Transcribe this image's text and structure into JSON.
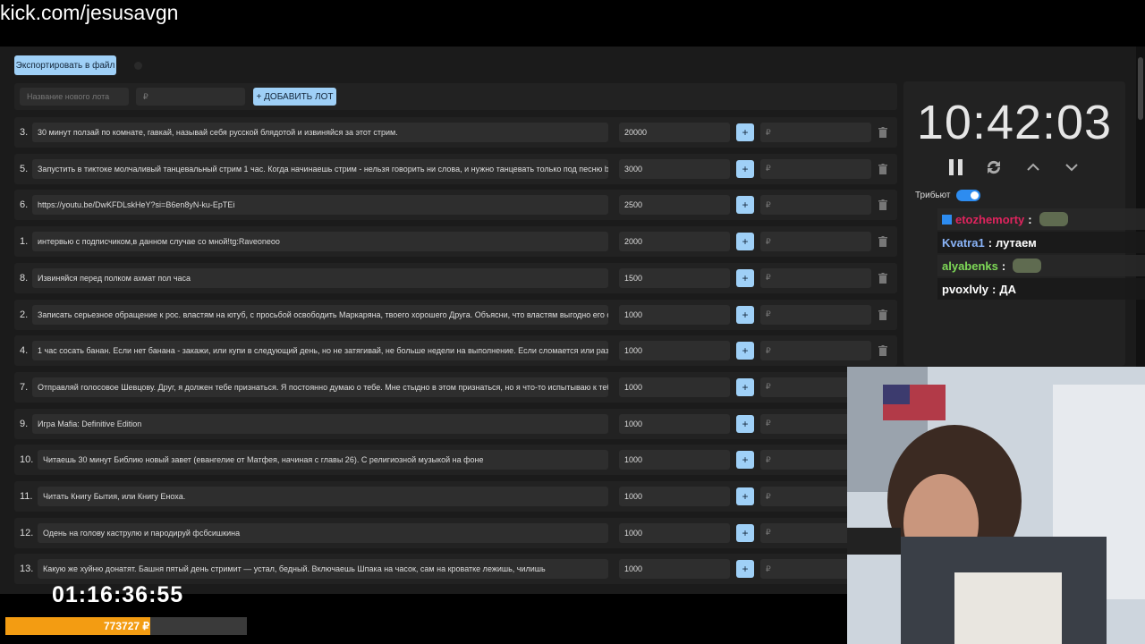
{
  "browser": {
    "url": "kick.com/jesusavgn"
  },
  "toolbar": {
    "export_label": "Экспортировать в файл"
  },
  "new_lot": {
    "name_placeholder": "Название нового лота",
    "amount_placeholder": "₽",
    "add_label": "+ ДОБАВИТЬ ЛОТ"
  },
  "lots": [
    {
      "num": "3.",
      "name": "30 минут ползай по комнате, гавкай, называй себя русской блядотой и извиняйся за этот стрим.",
      "amount": "20000",
      "plus": "+",
      "add_placeholder": "₽"
    },
    {
      "num": "5.",
      "name": "Запустить в тиктоке молчаливый танцевальный стрим 1 час. Когда начинаешь стрим - нельзя говорить ни слова, и нужно танцевать только под песню brid",
      "amount": "3000",
      "plus": "+",
      "add_placeholder": "₽"
    },
    {
      "num": "6.",
      "name": "https://youtu.be/DwKFDLskHeY?si=B6en8yN-ku-EpTEi",
      "amount": "2500",
      "plus": "+",
      "add_placeholder": "₽"
    },
    {
      "num": "1.",
      "name": "интервью с подписчиком,в данном случае со мной!tg:Raveoneoo",
      "amount": "2000",
      "plus": "+",
      "add_placeholder": "₽"
    },
    {
      "num": "8.",
      "name": "Извиняйся перед полком ахмат пол часа",
      "amount": "1500",
      "plus": "+",
      "add_placeholder": "₽"
    },
    {
      "num": "2.",
      "name": "Записать серьезное обращение к рос. властям на ютуб, с просьбой освободить Маркаряна, твоего хорошего Друга. Объясни, что властям выгодно его ос",
      "amount": "1000",
      "plus": "+",
      "add_placeholder": "₽"
    },
    {
      "num": "4.",
      "name": "1 час сосать банан. Если нет банана - закажи, или купи в следующий день, но не затягивай, не больше недели на выполнение. Если сломается или разм",
      "amount": "1000",
      "plus": "+",
      "add_placeholder": "₽"
    },
    {
      "num": "7.",
      "name": "Отправляй голосовое Шевцову. Друг, я должен тебе признаться. Я постоянно думаю о тебе. Мне стыдно в этом признаться, но я что-то испытываю к тебе",
      "amount": "1000",
      "plus": "+",
      "add_placeholder": "₽"
    },
    {
      "num": "9.",
      "name": "Игра Mafia: Definitive Edition",
      "amount": "1000",
      "plus": "+",
      "add_placeholder": "₽"
    },
    {
      "num": "10.",
      "name": "Читаешь 30 минут Библию новый завет (евангелие от Матфея, начиная с главы 26). С религиозной музыкой на фоне",
      "amount": "1000",
      "plus": "+",
      "add_placeholder": "₽"
    },
    {
      "num": "11.",
      "name": "Читать Книгу Бытия, или Книгу Еноха.",
      "amount": "1000",
      "plus": "+",
      "add_placeholder": "₽"
    },
    {
      "num": "12.",
      "name": "Одень на голову каструлю и пародируй фсбсишкина",
      "amount": "1000",
      "plus": "+",
      "add_placeholder": "₽"
    },
    {
      "num": "13.",
      "name": "Какую же хуйню донатят. Башня пятый день стримит — устал, бедный. Включаешь Шпака на часок, сам на кроватке лежишь, чилишь",
      "amount": "1000",
      "plus": "+",
      "add_placeholder": "₽"
    }
  ],
  "timer_panel": {
    "time": "10:42:03",
    "tribute_label": "Трибьют",
    "tribute_on": true
  },
  "chat": [
    {
      "user": "etozhemorty",
      "sep": ":",
      "message": "",
      "color": "#e0245e",
      "emote": true
    },
    {
      "user": "Kvatra1",
      "sep": ":",
      "message": "лутаем",
      "color": "#8ab4f8",
      "emote": false
    },
    {
      "user": "alyabenks",
      "sep": ":",
      "message": "",
      "color": "#7ed957",
      "emote": true
    },
    {
      "user": "pvoxlvly",
      "sep": ":",
      "message": "ДА",
      "color": "#ffffff",
      "emote": false
    }
  ],
  "overlay": {
    "stream_timer": "01:16:36:55",
    "progress_value": "773727 ₽",
    "progress_fraction": 0.6
  },
  "colors": {
    "accent": "#9fd0f7",
    "progress": "#f39c12",
    "toggle": "#2d8cf0"
  }
}
